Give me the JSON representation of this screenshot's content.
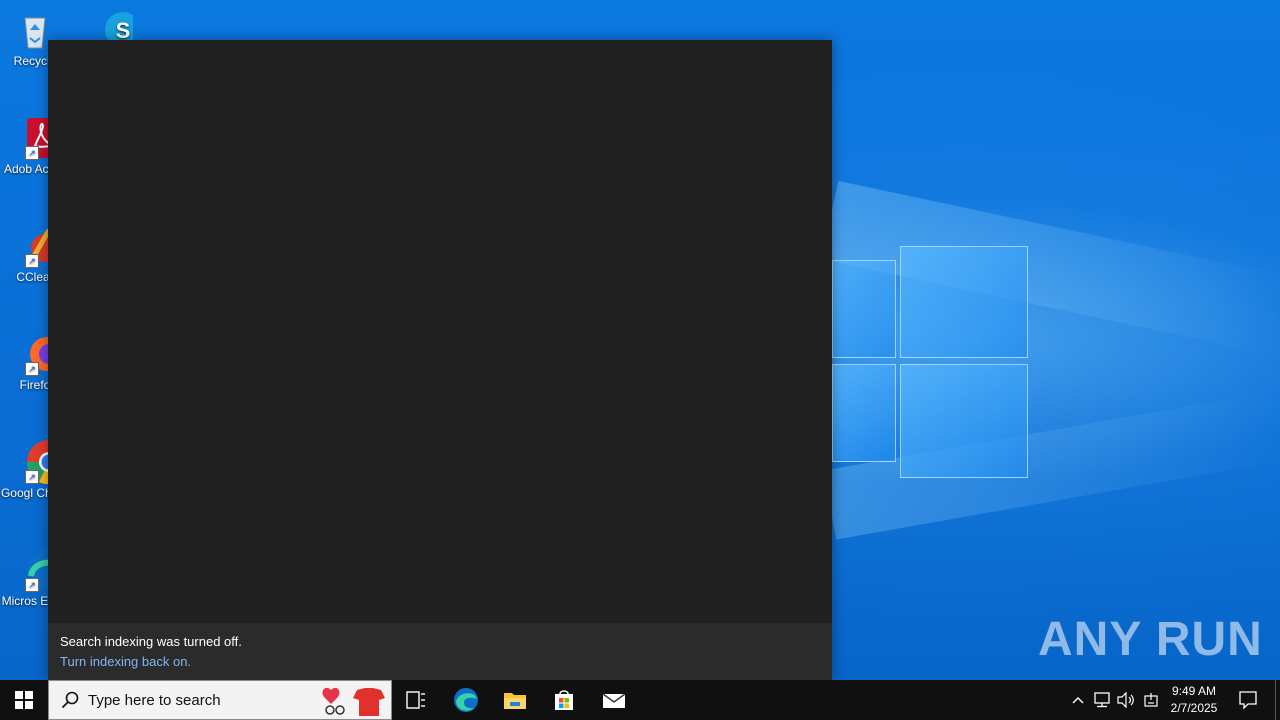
{
  "desktop": {
    "icons": [
      {
        "label": "Recycle",
        "name": "recycle-bin"
      },
      {
        "label": "Adob Acrob",
        "name": "adobe-acrobat"
      },
      {
        "label": "CClear",
        "name": "ccleaner"
      },
      {
        "label": "Firefo",
        "name": "firefox"
      },
      {
        "label": "Googl Chron",
        "name": "google-chrome"
      },
      {
        "label": "Micros Edge",
        "name": "microsoft-edge"
      },
      {
        "label": "",
        "name": "skype"
      }
    ],
    "watermark": "ANY RUN"
  },
  "search_panel": {
    "footer_message": "Search indexing was turned off.",
    "footer_link": "Turn indexing back on."
  },
  "taskbar": {
    "search_placeholder": "Type here to search",
    "clock_time": "9:49 AM",
    "clock_date": "2/7/2025",
    "icons": [
      "windows-start-icon",
      "search-icon",
      "task-view-icon",
      "edge-icon",
      "file-explorer-icon",
      "store-icon",
      "mail-icon"
    ],
    "tray_icons": [
      "chevron-up-icon",
      "network-icon",
      "volume-icon",
      "input-icon",
      "notification-icon"
    ]
  },
  "colors": {
    "panel_bg": "#202020",
    "footer_bg": "#2b2b2b",
    "link": "#7fb7f5",
    "taskbar": "#101010",
    "desktop": "#0a6fd6"
  }
}
